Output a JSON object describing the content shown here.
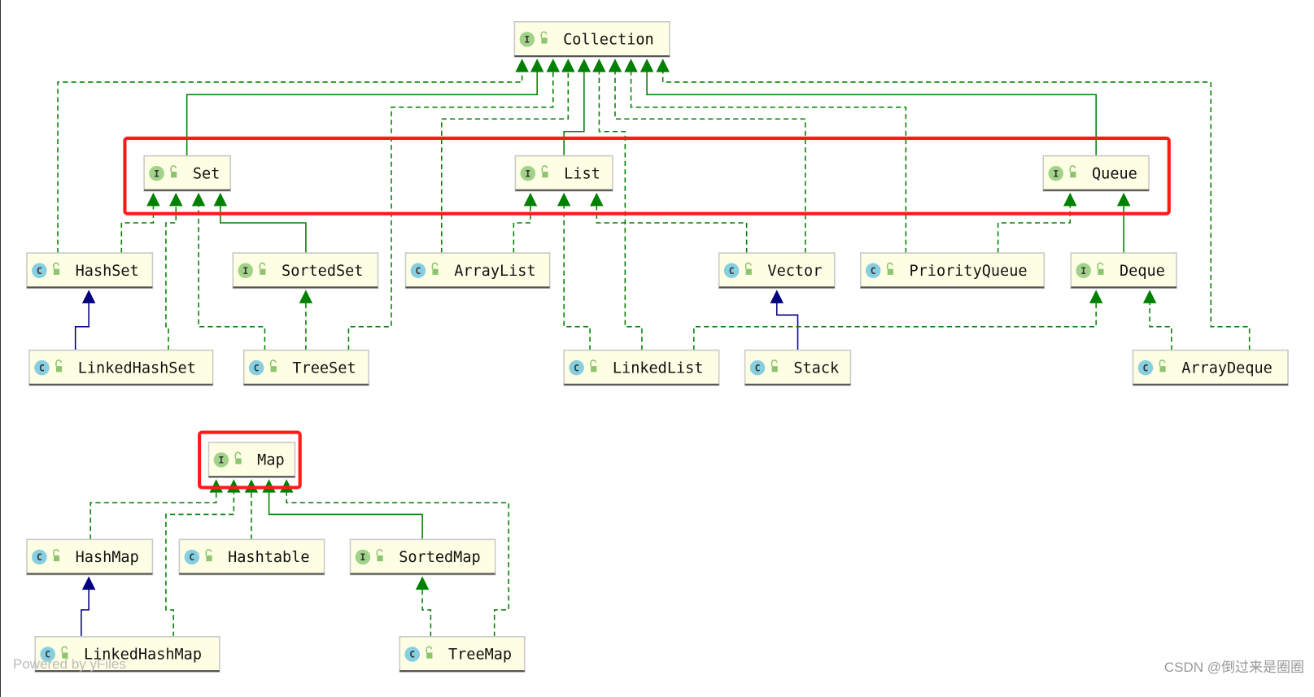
{
  "nodes": [
    {
      "id": "Collection",
      "kind": "I"
    },
    {
      "id": "Set",
      "kind": "I"
    },
    {
      "id": "List",
      "kind": "I"
    },
    {
      "id": "Queue",
      "kind": "I"
    },
    {
      "id": "HashSet",
      "kind": "C"
    },
    {
      "id": "SortedSet",
      "kind": "I"
    },
    {
      "id": "ArrayList",
      "kind": "C"
    },
    {
      "id": "Vector",
      "kind": "C"
    },
    {
      "id": "PriorityQueue",
      "kind": "C"
    },
    {
      "id": "Deque",
      "kind": "I"
    },
    {
      "id": "LinkedHashSet",
      "kind": "C"
    },
    {
      "id": "TreeSet",
      "kind": "C"
    },
    {
      "id": "LinkedList",
      "kind": "C"
    },
    {
      "id": "Stack",
      "kind": "C"
    },
    {
      "id": "ArrayDeque",
      "kind": "C"
    },
    {
      "id": "Map",
      "kind": "I"
    },
    {
      "id": "HashMap",
      "kind": "C"
    },
    {
      "id": "Hashtable",
      "kind": "C"
    },
    {
      "id": "SortedMap",
      "kind": "I"
    },
    {
      "id": "LinkedHashMap",
      "kind": "C"
    },
    {
      "id": "TreeMap",
      "kind": "C"
    }
  ],
  "edges": [
    {
      "from": "HashSet",
      "to": "Collection",
      "type": "implements"
    },
    {
      "from": "Set",
      "to": "Collection",
      "type": "extends-interface"
    },
    {
      "from": "TreeSet",
      "to": "Collection",
      "type": "implements"
    },
    {
      "from": "ArrayList",
      "to": "Collection",
      "type": "implements"
    },
    {
      "from": "List",
      "to": "Collection",
      "type": "extends-interface"
    },
    {
      "from": "LinkedList",
      "to": "Collection",
      "type": "implements"
    },
    {
      "from": "Vector",
      "to": "Collection",
      "type": "implements"
    },
    {
      "from": "PriorityQueue",
      "to": "Collection",
      "type": "implements"
    },
    {
      "from": "Queue",
      "to": "Collection",
      "type": "extends-interface"
    },
    {
      "from": "ArrayDeque",
      "to": "Collection",
      "type": "implements"
    },
    {
      "from": "HashSet",
      "to": "Set",
      "type": "implements"
    },
    {
      "from": "LinkedHashSet",
      "to": "Set",
      "type": "implements"
    },
    {
      "from": "TreeSet",
      "to": "Set",
      "type": "implements"
    },
    {
      "from": "SortedSet",
      "to": "Set",
      "type": "extends-interface"
    },
    {
      "from": "LinkedHashSet",
      "to": "HashSet",
      "type": "extends-class"
    },
    {
      "from": "TreeSet",
      "to": "SortedSet",
      "type": "implements"
    },
    {
      "from": "ArrayList",
      "to": "List",
      "type": "implements"
    },
    {
      "from": "LinkedList",
      "to": "List",
      "type": "implements"
    },
    {
      "from": "Vector",
      "to": "List",
      "type": "implements"
    },
    {
      "from": "Stack",
      "to": "Vector",
      "type": "extends-class"
    },
    {
      "from": "PriorityQueue",
      "to": "Queue",
      "type": "implements"
    },
    {
      "from": "Deque",
      "to": "Queue",
      "type": "extends-interface"
    },
    {
      "from": "LinkedList",
      "to": "Deque",
      "type": "implements"
    },
    {
      "from": "ArrayDeque",
      "to": "Deque",
      "type": "implements"
    },
    {
      "from": "HashMap",
      "to": "Map",
      "type": "implements"
    },
    {
      "from": "LinkedHashMap",
      "to": "Map",
      "type": "implements"
    },
    {
      "from": "Hashtable",
      "to": "Map",
      "type": "implements"
    },
    {
      "from": "SortedMap",
      "to": "Map",
      "type": "extends-interface"
    },
    {
      "from": "TreeMap",
      "to": "Map",
      "type": "implements"
    },
    {
      "from": "LinkedHashMap",
      "to": "HashMap",
      "type": "extends-class"
    },
    {
      "from": "TreeMap",
      "to": "SortedMap",
      "type": "implements"
    }
  ],
  "highlights": [
    "Set, List, Queue",
    "Map"
  ],
  "colors": {
    "node_fill": "#fefee4",
    "interface_edge": "#008000",
    "class_edge": "#000080",
    "highlight": "#ff1a1a",
    "class_icon": "#87cfe0",
    "interface_icon": "#a1d28a"
  },
  "footer": {
    "powered": "Powered by yFiles",
    "watermark": "CSDN @倒过来是圈圈"
  }
}
